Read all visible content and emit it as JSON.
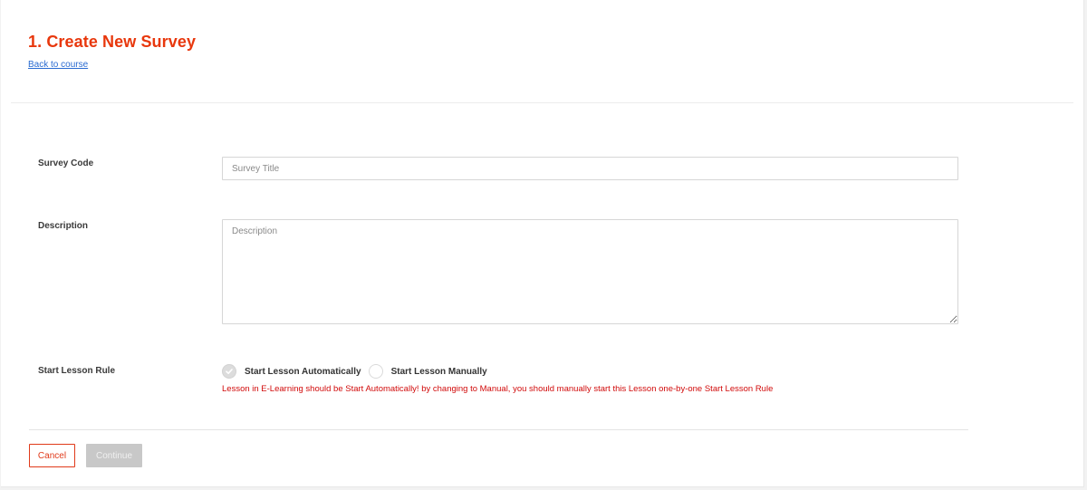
{
  "header": {
    "title": "1. Create New Survey",
    "back_link": "Back to course"
  },
  "form": {
    "survey_code": {
      "label": "Survey Code",
      "value": "",
      "placeholder": "Survey Title"
    },
    "description": {
      "label": "Description",
      "value": "",
      "placeholder": "Description"
    },
    "start_lesson_rule": {
      "label": "Start Lesson Rule",
      "options": [
        {
          "label": "Start Lesson Automatically",
          "checked": true,
          "disabled": true
        },
        {
          "label": "Start Lesson Manually",
          "checked": false,
          "disabled": false
        }
      ],
      "warning": "Lesson in E-Learning should be Start Automatically! by changing to Manual, you should manually start this Lesson one-by-one Start Lesson Rule"
    }
  },
  "actions": {
    "cancel_label": "Cancel",
    "continue_label": "Continue",
    "continue_disabled": true
  },
  "colors": {
    "accent": "#e8370c",
    "link": "#2a6bd1",
    "warning": "#d10a0a",
    "disabled_button": "#c8c8c8"
  },
  "icons": {
    "checked_radio": "check-icon"
  }
}
